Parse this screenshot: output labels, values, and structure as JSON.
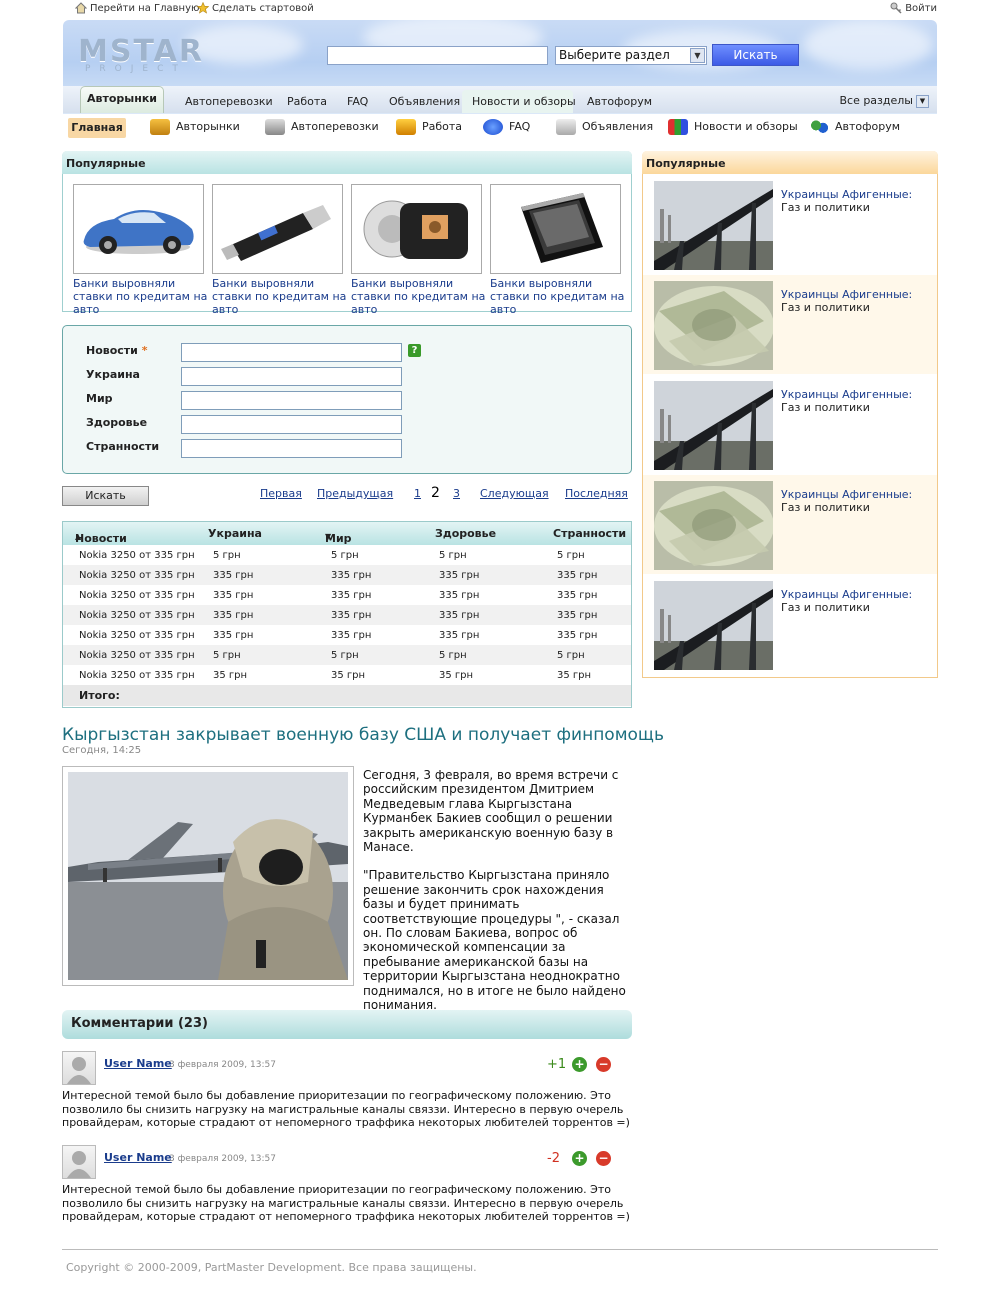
{
  "topbar": {
    "home_link": "Перейти на Главную",
    "set_start": "Сделать стартовой",
    "login": "Войти"
  },
  "logo": {
    "main": "MSTAR",
    "sub": "PROJECT"
  },
  "search": {
    "placeholder": "",
    "section_select": "Выберите раздел",
    "button": "Искать"
  },
  "tabs": [
    "Авторынки",
    "Автоперевозки",
    "Работа",
    "FAQ",
    "Объявления",
    "Новости и обзоры",
    "Автофорум"
  ],
  "tabs_all": "Все разделы",
  "iconnav": {
    "main": "Главная",
    "items": [
      "Авторынки",
      "Автоперевозки",
      "Работа",
      "FAQ",
      "Объявления",
      "Новости и обзоры",
      "Автофорум"
    ]
  },
  "popular": {
    "title": "Популярные",
    "items": [
      {
        "caption": "Банки выровняли ставки по кредитам на авто"
      },
      {
        "caption": "Банки выровняли ставки по кредитам на авто"
      },
      {
        "caption": "Банки выровняли ставки по кредитам на авто"
      },
      {
        "caption": "Банки выровняли ставки по кредитам на авто"
      }
    ]
  },
  "form": {
    "fields": [
      "Новости",
      "Украина",
      "Мир",
      "Здоровье",
      "Странности"
    ],
    "required_mark": "*",
    "help": "?",
    "button": "Искать"
  },
  "pager": {
    "first": "Первая",
    "prev": "Предыдущая",
    "pages": [
      "1",
      "2",
      "3"
    ],
    "current": "2",
    "next": "Следующая",
    "last": "Последняя"
  },
  "table": {
    "headers": [
      "Новости",
      "Украина",
      "Мир",
      "Здоровье",
      "Странности"
    ],
    "rows": [
      [
        "Nokia 3250 от 335 грн",
        "5 грн",
        "5 грн",
        "5 грн",
        "5 грн"
      ],
      [
        "Nokia 3250 от 335 грн",
        "335 грн",
        "335 грн",
        "335 грн",
        "335 грн"
      ],
      [
        "Nokia 3250 от 335 грн",
        "335 грн",
        "335 грн",
        "335 грн",
        "335 грн"
      ],
      [
        "Nokia 3250 от 335 грн",
        "335 грн",
        "335 грн",
        "335 грн",
        "335 грн"
      ],
      [
        "Nokia 3250 от 335 грн",
        "335 грн",
        "335 грн",
        "335 грн",
        "335 грн"
      ],
      [
        "Nokia 3250 от 335 грн",
        "5 грн",
        "5 грн",
        "5 грн",
        "5 грн"
      ],
      [
        "Nokia 3250 от 335 грн",
        "35 грн",
        "35 грн",
        "35 грн",
        "35 грн"
      ]
    ],
    "total": "Итого:"
  },
  "sidebar": {
    "title": "Популярные",
    "items": [
      {
        "title": "Украинцы Афигенные:",
        "sub": "Газ и политики",
        "image": "bridge"
      },
      {
        "title": "Украинцы Афигенные:",
        "sub": "Газ и политики",
        "image": "money"
      },
      {
        "title": "Украинцы Афигенные:",
        "sub": "Газ и политики",
        "image": "bridge"
      },
      {
        "title": "Украинцы Афигенные:",
        "sub": "Газ и политики",
        "image": "money"
      },
      {
        "title": "Украинцы Афигенные:",
        "sub": "Газ и политики",
        "image": "bridge"
      }
    ]
  },
  "article": {
    "title": "Кыргызстан закрывает военную базу США и получает финпомощь",
    "date": "Сегодня, 14:25",
    "p1": "Сегодня, 3 февраля, во время встречи с российским президентом Дмитрием Медведевым глава Кыргызстана Курманбек Бакиев сообщил о решении закрыть американскую военную базу в Манасе.",
    "p2": "\"Правительство Кыргызстана приняло решение закончить срок нахождения базы и будет принимать соответствующие процедуры \", - сказал он. По словам Бакиева, вопрос об экономической компенсации за пребывание американской базы на территории Кыргызстана неоднократно поднимался, но в итоге не было найдено понимания."
  },
  "comments": {
    "title": "Комментарии (23)",
    "items": [
      {
        "user": "User Name",
        "date": "3 февраля 2009, 13:57",
        "score": "+1",
        "text": "Интересной темой было бы добавление приоритезации по географическому положению. Это позволило бы снизить нагрузку на магистральные каналы связзи. Интересно в первую очерель провайдерам, которые страдают от непомерного траффика некоторых любителей торрентов =)"
      },
      {
        "user": "User Name",
        "date": "3 февраля 2009, 13:57",
        "score": "-2",
        "text": "Интересной темой было бы добавление приоритезации по географическому положению. Это позволило бы снизить нагрузку на магистральные каналы связзи. Интересно в первую очерель провайдерам, которые страдают от непомерного траффика некоторых любителей торрентов =)"
      }
    ],
    "plus": "+",
    "minus": "−"
  },
  "footer": {
    "copyright": "Copyright © 2000-2009, PartMaster Development. Все права защищены."
  },
  "colors": {
    "accent": "#1d6f7f",
    "link": "#1a3c8c",
    "positive": "#3a8a1a",
    "negative": "#d03020"
  }
}
